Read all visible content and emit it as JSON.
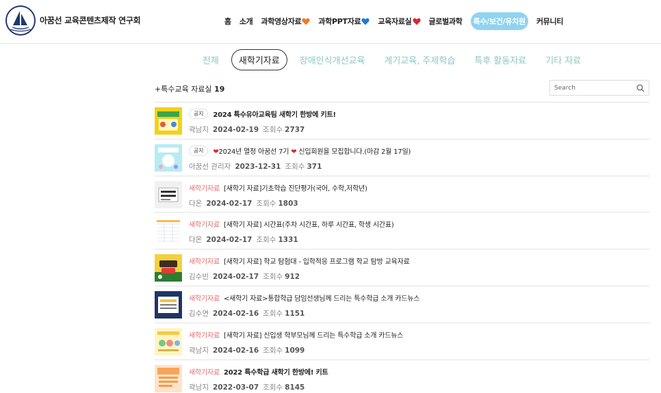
{
  "header": {
    "site_name": "아꿈선 교육콘텐츠제작 연구회",
    "nav": [
      {
        "label": "홈",
        "icon": ""
      },
      {
        "label": "소개",
        "icon": ""
      },
      {
        "label": "과학영상자료",
        "icon": "orange-heart-icon"
      },
      {
        "label": "과학PPT자료",
        "icon": "blue-heart-icon"
      },
      {
        "label": "교육자료실",
        "icon": "red-heart-icon"
      },
      {
        "label": "글로벌과학",
        "icon": ""
      },
      {
        "label": "특수/보건/유치원",
        "icon": "",
        "active": true
      },
      {
        "label": "커뮤니티",
        "icon": ""
      }
    ]
  },
  "subtabs": [
    "전체",
    "새학기자료",
    "장애인식개선교육",
    "계기교육, 주제학습",
    "특후 활동자료",
    "기타 자료"
  ],
  "subtab_active": "새학기자료",
  "board": {
    "title_prefix": "+특수교육 자료실",
    "count": "19",
    "search_placeholder": "Search"
  },
  "posts": [
    {
      "badge": "공지",
      "category": "",
      "title": "2024 특수유아교육팀 새학기 한방에 키트!",
      "bold": true,
      "author": "곽남지",
      "date": "2024-02-19",
      "views_label": "조회수",
      "views": "2737",
      "thumb": "yellow"
    },
    {
      "badge": "공지",
      "category": "",
      "title": "❤2024년 열정 아꿈선 7기 ❤ 신입회원을 모집합니다.(마감 2월 17일)",
      "bold": false,
      "author": "아꿈선 관리자",
      "date": "2023-12-31",
      "views_label": "조회수",
      "views": "371",
      "thumb": "cyan"
    },
    {
      "badge": "",
      "category": "새학기자료",
      "title": "[새학기 자료]기초학습 진단평가(국어, 수학,저학년)",
      "bold": false,
      "author": "다온",
      "date": "2024-02-17",
      "views_label": "조회수",
      "views": "1803",
      "thumb": "grey"
    },
    {
      "badge": "",
      "category": "새학기자료",
      "title": "[새학기 자료] 시간표(주차 시간표, 하루 시간표, 학생 시간표)",
      "bold": false,
      "author": "다온",
      "date": "2024-02-17",
      "views_label": "조회수",
      "views": "1331",
      "thumb": "table"
    },
    {
      "badge": "",
      "category": "새학기자료",
      "title": "[새학기 자료] 학교 탐험대 - 입학적응 프로그램 학교 탐방 교육자료",
      "bold": false,
      "author": "김수빈",
      "date": "2024-02-17",
      "views_label": "조회수",
      "views": "912",
      "thumb": "green"
    },
    {
      "badge": "",
      "category": "새학기자료",
      "title": "<새학기 자료>통합학급 담임선생님께 드리는 특수학급 소개 카드뉴스",
      "bold": false,
      "author": "김수연",
      "date": "2024-02-16",
      "views_label": "조회수",
      "views": "1151",
      "thumb": "navy"
    },
    {
      "badge": "",
      "category": "새학기자료",
      "title": "[새학기 자료] 신입생 학부모님께 드리는 특수학급 소개 카드뉴스",
      "bold": false,
      "author": "곽남지",
      "date": "2024-02-16",
      "views_label": "조회수",
      "views": "1099",
      "thumb": "lightyellow"
    },
    {
      "badge": "",
      "category": "새학기자료",
      "title": "2022 특수학급 새학기 한방에! 키트",
      "bold": true,
      "author": "곽남지",
      "date": "2022-03-07",
      "views_label": "조회수",
      "views": "8145",
      "thumb": "peach"
    }
  ]
}
